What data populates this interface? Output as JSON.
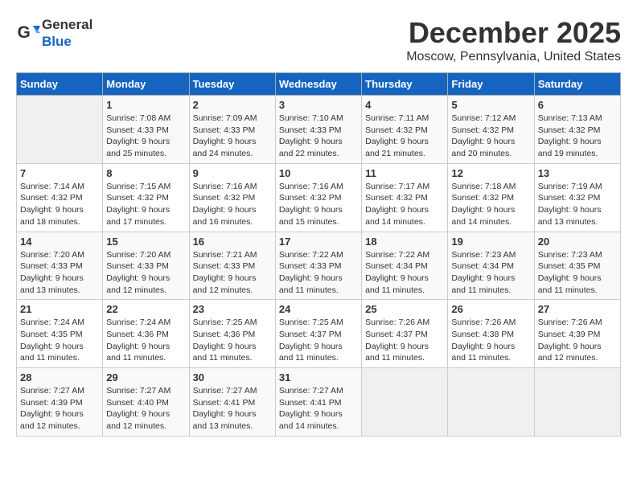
{
  "header": {
    "logo_general": "General",
    "logo_blue": "Blue",
    "month_title": "December 2025",
    "location": "Moscow, Pennsylvania, United States"
  },
  "weekdays": [
    "Sunday",
    "Monday",
    "Tuesday",
    "Wednesday",
    "Thursday",
    "Friday",
    "Saturday"
  ],
  "weeks": [
    [
      {
        "day": "",
        "empty": true
      },
      {
        "day": "1",
        "sunrise": "7:08 AM",
        "sunset": "4:33 PM",
        "daylight": "9 hours and 25 minutes."
      },
      {
        "day": "2",
        "sunrise": "7:09 AM",
        "sunset": "4:33 PM",
        "daylight": "9 hours and 24 minutes."
      },
      {
        "day": "3",
        "sunrise": "7:10 AM",
        "sunset": "4:33 PM",
        "daylight": "9 hours and 22 minutes."
      },
      {
        "day": "4",
        "sunrise": "7:11 AM",
        "sunset": "4:32 PM",
        "daylight": "9 hours and 21 minutes."
      },
      {
        "day": "5",
        "sunrise": "7:12 AM",
        "sunset": "4:32 PM",
        "daylight": "9 hours and 20 minutes."
      },
      {
        "day": "6",
        "sunrise": "7:13 AM",
        "sunset": "4:32 PM",
        "daylight": "9 hours and 19 minutes."
      }
    ],
    [
      {
        "day": "7",
        "sunrise": "7:14 AM",
        "sunset": "4:32 PM",
        "daylight": "9 hours and 18 minutes."
      },
      {
        "day": "8",
        "sunrise": "7:15 AM",
        "sunset": "4:32 PM",
        "daylight": "9 hours and 17 minutes."
      },
      {
        "day": "9",
        "sunrise": "7:16 AM",
        "sunset": "4:32 PM",
        "daylight": "9 hours and 16 minutes."
      },
      {
        "day": "10",
        "sunrise": "7:16 AM",
        "sunset": "4:32 PM",
        "daylight": "9 hours and 15 minutes."
      },
      {
        "day": "11",
        "sunrise": "7:17 AM",
        "sunset": "4:32 PM",
        "daylight": "9 hours and 14 minutes."
      },
      {
        "day": "12",
        "sunrise": "7:18 AM",
        "sunset": "4:32 PM",
        "daylight": "9 hours and 14 minutes."
      },
      {
        "day": "13",
        "sunrise": "7:19 AM",
        "sunset": "4:32 PM",
        "daylight": "9 hours and 13 minutes."
      }
    ],
    [
      {
        "day": "14",
        "sunrise": "7:20 AM",
        "sunset": "4:33 PM",
        "daylight": "9 hours and 13 minutes."
      },
      {
        "day": "15",
        "sunrise": "7:20 AM",
        "sunset": "4:33 PM",
        "daylight": "9 hours and 12 minutes."
      },
      {
        "day": "16",
        "sunrise": "7:21 AM",
        "sunset": "4:33 PM",
        "daylight": "9 hours and 12 minutes."
      },
      {
        "day": "17",
        "sunrise": "7:22 AM",
        "sunset": "4:33 PM",
        "daylight": "9 hours and 11 minutes."
      },
      {
        "day": "18",
        "sunrise": "7:22 AM",
        "sunset": "4:34 PM",
        "daylight": "9 hours and 11 minutes."
      },
      {
        "day": "19",
        "sunrise": "7:23 AM",
        "sunset": "4:34 PM",
        "daylight": "9 hours and 11 minutes."
      },
      {
        "day": "20",
        "sunrise": "7:23 AM",
        "sunset": "4:35 PM",
        "daylight": "9 hours and 11 minutes."
      }
    ],
    [
      {
        "day": "21",
        "sunrise": "7:24 AM",
        "sunset": "4:35 PM",
        "daylight": "9 hours and 11 minutes."
      },
      {
        "day": "22",
        "sunrise": "7:24 AM",
        "sunset": "4:36 PM",
        "daylight": "9 hours and 11 minutes."
      },
      {
        "day": "23",
        "sunrise": "7:25 AM",
        "sunset": "4:36 PM",
        "daylight": "9 hours and 11 minutes."
      },
      {
        "day": "24",
        "sunrise": "7:25 AM",
        "sunset": "4:37 PM",
        "daylight": "9 hours and 11 minutes."
      },
      {
        "day": "25",
        "sunrise": "7:26 AM",
        "sunset": "4:37 PM",
        "daylight": "9 hours and 11 minutes."
      },
      {
        "day": "26",
        "sunrise": "7:26 AM",
        "sunset": "4:38 PM",
        "daylight": "9 hours and 11 minutes."
      },
      {
        "day": "27",
        "sunrise": "7:26 AM",
        "sunset": "4:39 PM",
        "daylight": "9 hours and 12 minutes."
      }
    ],
    [
      {
        "day": "28",
        "sunrise": "7:27 AM",
        "sunset": "4:39 PM",
        "daylight": "9 hours and 12 minutes."
      },
      {
        "day": "29",
        "sunrise": "7:27 AM",
        "sunset": "4:40 PM",
        "daylight": "9 hours and 12 minutes."
      },
      {
        "day": "30",
        "sunrise": "7:27 AM",
        "sunset": "4:41 PM",
        "daylight": "9 hours and 13 minutes."
      },
      {
        "day": "31",
        "sunrise": "7:27 AM",
        "sunset": "4:41 PM",
        "daylight": "9 hours and 14 minutes."
      },
      {
        "day": "",
        "empty": true
      },
      {
        "day": "",
        "empty": true
      },
      {
        "day": "",
        "empty": true
      }
    ]
  ]
}
